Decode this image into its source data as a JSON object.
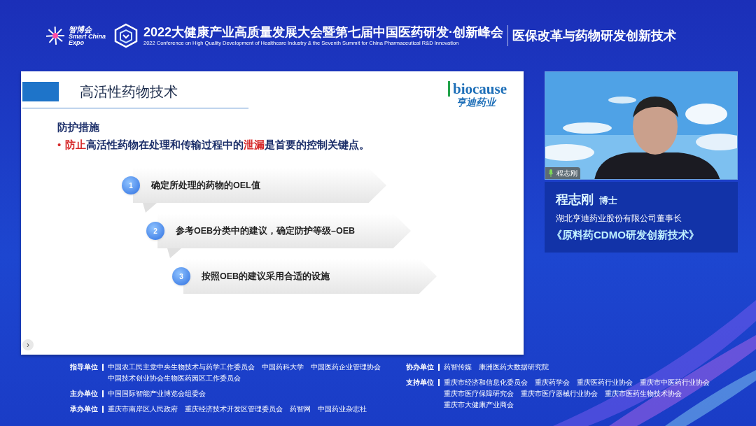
{
  "header": {
    "logo_lines": [
      "智博会",
      "Smart China",
      "Expo"
    ],
    "title": "2022大健康产业高质量发展大会暨第七届中国医药研发·创新峰会",
    "subtitle": "2022 Conference on High Quality Development of Healthcare  Industry &  the Seventh Summit for China Pharmaceutical  R&D Innovation",
    "topic": "医保改革与药物研发创新技术"
  },
  "slide": {
    "title": "高活性药物技术",
    "logo": {
      "brand": "biocause",
      "subtitle": "亨迪药业"
    },
    "section": "防护措施",
    "bullet_mark": "•",
    "bullet": [
      {
        "text": "防止",
        "emphasis": true
      },
      {
        "text": "高活性药物在处理和传输过程中的",
        "emphasis": false
      },
      {
        "text": "泄漏",
        "emphasis": true
      },
      {
        "text": "是首要的控制关键点。",
        "emphasis": false
      }
    ],
    "steps": [
      {
        "number": "1",
        "text": "确定所处理的药物的OEL值"
      },
      {
        "number": "2",
        "text": "参考OEB分类中的建议，确定防护等级–OEB"
      },
      {
        "number": "3",
        "text": "按照OEB的建议采用合适的设施"
      }
    ],
    "nav": "›"
  },
  "video": {
    "name_tag": "程志刚"
  },
  "speaker": {
    "name": "程志刚",
    "honorific": "博士",
    "org": "湖北亨迪药业股份有限公司董事长",
    "talk": "《原料药CDMO研发创新技术》"
  },
  "footer": {
    "left": [
      {
        "label": "指导单位",
        "lines": [
          [
            "中国农工民主党中央生物技术与药学工作委员会",
            "中国药科大学",
            "中国医药企业管理协会"
          ],
          [
            "中国技术创业协会生物医药园区工作委员会"
          ]
        ]
      },
      {
        "label": "主办单位",
        "lines": [
          [
            "中国国际智能产业博览会组委会"
          ]
        ]
      },
      {
        "label": "承办单位",
        "lines": [
          [
            "重庆市南岸区人民政府",
            "重庆经济技术开发区管理委员会",
            "药智网",
            "中国药业杂志社"
          ]
        ]
      }
    ],
    "right": [
      {
        "label": "协办单位",
        "lines": [
          [
            "药智传媒",
            "康洲医药大数据研究院"
          ]
        ]
      },
      {
        "label": "支持单位",
        "lines": [
          [
            "重庆市经济和信息化委员会",
            "重庆药学会",
            "重庆医药行业协会",
            "重庆市中医药行业协会"
          ],
          [
            "重庆市医疗保障研究会",
            "重庆市医疗器械行业协会",
            "重庆市医药生物技术协会"
          ],
          [
            "重庆市大健康产业商会"
          ]
        ]
      }
    ]
  }
}
